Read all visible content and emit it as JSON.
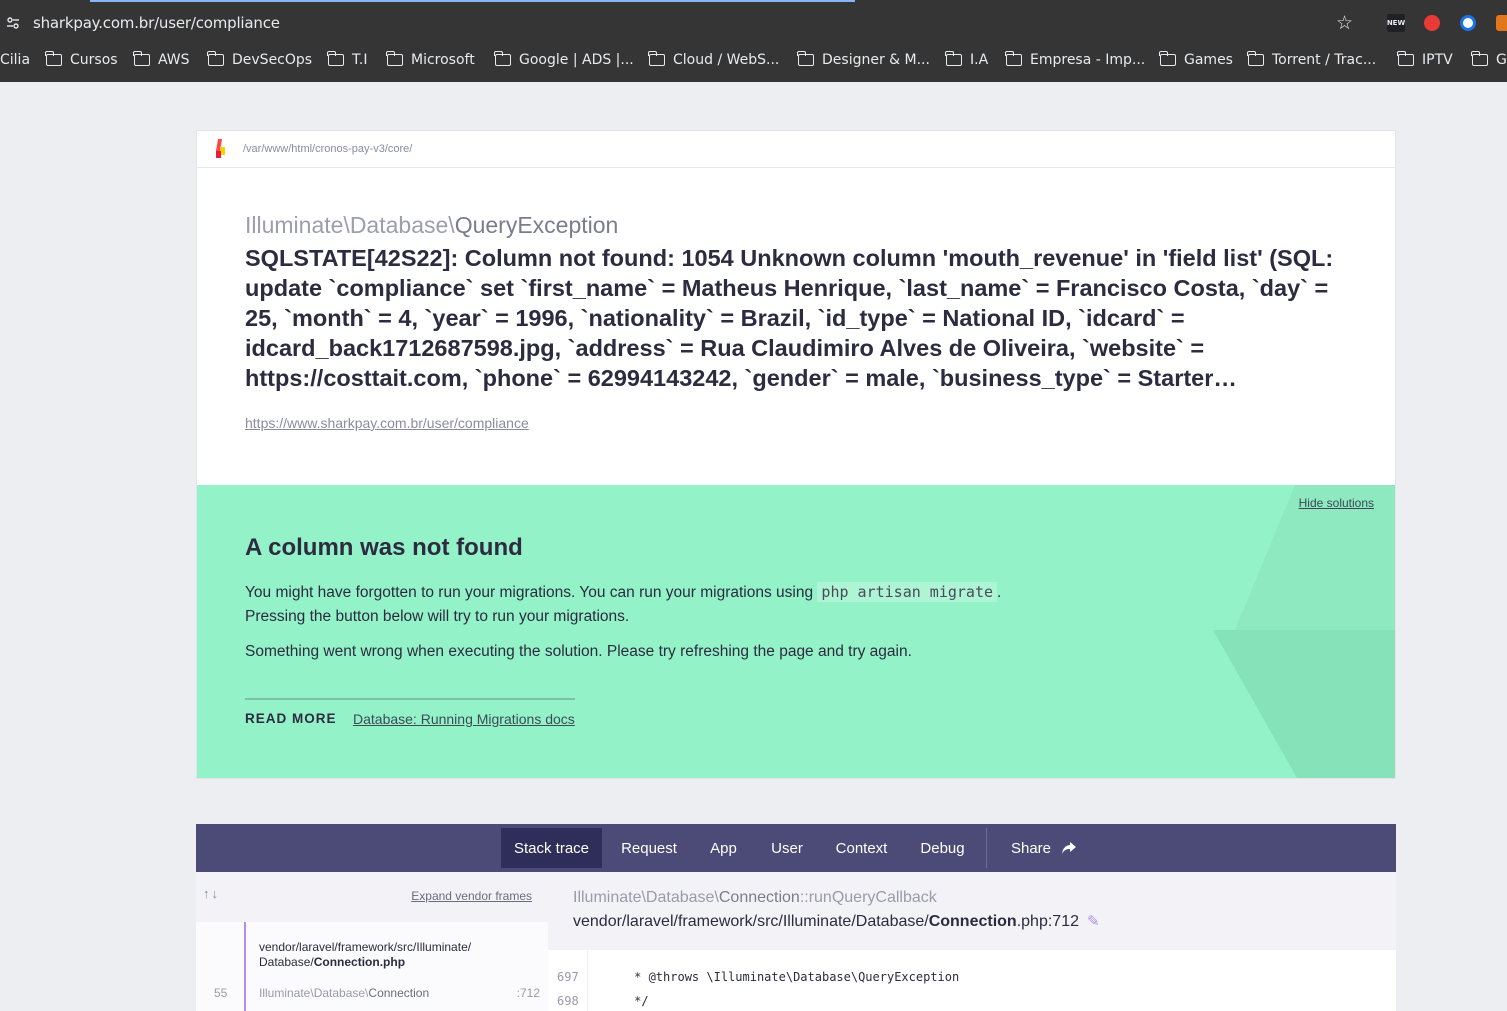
{
  "browser": {
    "url": "sharkpay.com.br/user/compliance",
    "ext_new_label": "NEW",
    "bookmarks": [
      "Cilia",
      "Cursos",
      "AWS",
      "DevSecOps",
      "T.I",
      "Microsoft",
      "Google | ADS |...",
      "Cloud / WebS...",
      "Designer & M...",
      "I.A",
      "Empresa - Imp...",
      "Games",
      "Torrent / Trac...",
      "IPTV",
      "G"
    ]
  },
  "header": {
    "path": "/var/www/html/cronos-pay-v3/core/"
  },
  "exception": {
    "namespace": "Illuminate\\Database\\",
    "class": "QueryException",
    "message": "SQLSTATE[42S22]: Column not found: 1054 Unknown column 'mouth_revenue' in 'field list' (SQL: update `compliance` set `first_name` = Matheus Henrique, `last_name` = Francisco Costa, `day` = 25, `month` = 4, `year` = 1996, `nationality` = Brazil, `id_type` = National ID, `idcard` = idcard_back1712687598.jpg, `address` = Rua Claudimiro Alves de Oliveira, `website` = https://costtait.com, `phone` = 62994143242, `gender` = male, `business_type` = Starter…",
    "url": "https://www.sharkpay.com.br/user/compliance"
  },
  "solution": {
    "hide_label": "Hide solutions",
    "title": "A column was not found",
    "text_before_code": "You might have forgotten to run your migrations. You can run your migrations using",
    "code": "php artisan migrate",
    "text_after_code": ".",
    "text_line2": "Pressing the button below will try to run your migrations.",
    "error_text": "Something went wrong when executing the solution. Please try refreshing the page and try again.",
    "read_more": "READ MORE",
    "doc_link": "Database: Running Migrations docs",
    "colors": {
      "background": "#94f2c8"
    }
  },
  "tabs": {
    "items": [
      "Stack trace",
      "Request",
      "App",
      "User",
      "Context",
      "Debug"
    ],
    "active": "Stack trace",
    "share": "Share"
  },
  "stack": {
    "arrows": "↑↓",
    "expand_label": "Expand vendor frames",
    "frame": {
      "file_dir_line1": "vendor/laravel/framework/src/Illuminate/",
      "file_dir_line2": "Database/",
      "file_name": "Connection.php",
      "number": "55",
      "class_ns": "Illuminate\\Database\\",
      "class_name": "Connection",
      "line": ":712"
    },
    "current": {
      "class_ns": "Illuminate\\Database\\",
      "class_name": "Connection",
      "method": "::runQueryCallback",
      "file_dir": "vendor/laravel/framework/src/Illuminate/Database/",
      "file_name": "Connection",
      "file_ext_line": ".php:712"
    },
    "code_lines": [
      {
        "number": "697",
        "text": "     * @throws \\Illuminate\\Database\\QueryException"
      },
      {
        "number": "698",
        "text": "     */"
      }
    ]
  }
}
